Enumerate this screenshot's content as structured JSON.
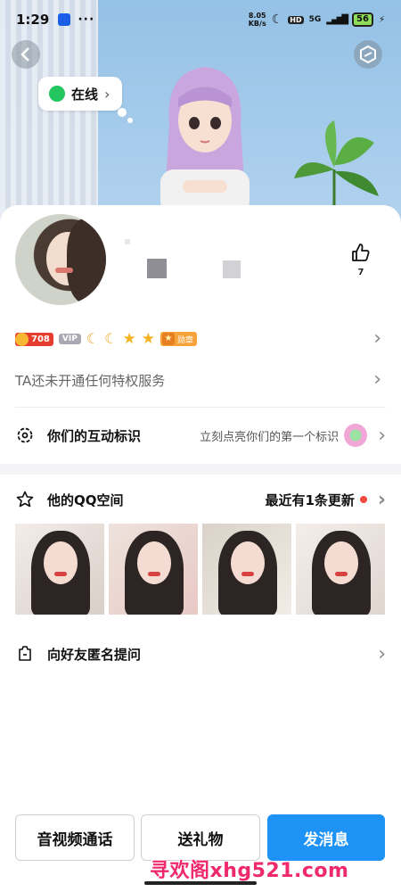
{
  "status_bar": {
    "time": "1:29",
    "dots": "···",
    "net_speed_value": "8.05",
    "net_speed_unit": "KB/s",
    "signal": "5G",
    "hd": "HD",
    "battery": "56"
  },
  "hero": {
    "online_status": "在线"
  },
  "profile": {
    "like_count": "7",
    "level_badge": "708",
    "vip_label": "VIP",
    "honor_label": "勋章",
    "privilege_text": "TA还未开通任何特权服务"
  },
  "interaction": {
    "label": "你们的互动标识",
    "hint": "立刻点亮你们的第一个标识"
  },
  "qzone": {
    "label": "他的QQ空间",
    "update_text": "最近有1条更新"
  },
  "anonymous": {
    "label": "向好友匿名提问"
  },
  "bottom_bar": {
    "call_label": "音视频通话",
    "gift_label": "送礼物",
    "message_label": "发消息"
  },
  "watermark": "寻欢阁xhg521.com",
  "colors": {
    "accent_blue": "#1e93f5",
    "online_green": "#22c55e",
    "update_dot": "#f04a3c",
    "level_red": "#e63e2e"
  },
  "icons": {
    "back": "chevron-left-icon",
    "more": "hexagon-settings-icon",
    "like": "thumbs-up-icon",
    "interaction": "gear-badge-icon",
    "qzone": "star-outline-icon",
    "anonymous": "question-bag-icon"
  }
}
